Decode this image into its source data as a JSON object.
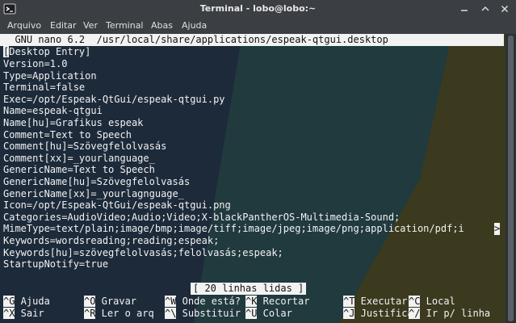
{
  "window": {
    "title": "Terminal - lobo@lobo:~",
    "controls": [
      "minimize-icon",
      "maximize-icon",
      "close-icon"
    ]
  },
  "menu": [
    "Arquivo",
    "Editar",
    "Ver",
    "Terminal",
    "Abas",
    "Ajuda"
  ],
  "nano": {
    "version": "GNU nano 6.2",
    "file_path": "/usr/local/share/applications/espeak-qtgui.desktop",
    "cursor_line_rest": "Desktop Entry]",
    "cursor_char": "[",
    "lines": [
      "Version=1.0",
      "Type=Application",
      "Terminal=false",
      "Exec=/opt/Espeak-QtGui/espeak-qtgui.py",
      "Name=espeak-qtgui",
      "Name[hu]=Grafikus espeak",
      "Comment=Text to Speech",
      "Comment[hu]=Szövegfelolvasás",
      "Comment[xx]=_yourlanguage_",
      "GenericName=Text to Speech",
      "GenericName[hu]=Szövegfelolvasás",
      "GenericName[xx]=_yourlagnguage_",
      "Icon=/opt/Espeak-QtGui/espeak-qtgui.png",
      "Categories=AudioVideo;Audio;Video;X-blackPantherOS-Multimedia-Sound;",
      "MimeType=text/plain;image/bmp;image/tiff;image/jpeg;image/png;application/pdf;i",
      "Keywords=wordsreading;reading;espeak;",
      "Keywords[hu]=szövegfelolvasás;felolvasás;espeak;",
      "StartupNotify=true"
    ],
    "overflow_marker": ">",
    "status": "[ 20 linhas lidas ]",
    "shortcuts_row1": [
      {
        "key": "^G",
        "label": " Ajuda"
      },
      {
        "key": "^O",
        "label": " Gravar"
      },
      {
        "key": "^W",
        "label": " Onde está?"
      },
      {
        "key": "^K",
        "label": " Recortar"
      },
      {
        "key": "^T",
        "label": " Executar"
      },
      {
        "key": "^C",
        "label": " Local"
      }
    ],
    "shortcuts_row2": [
      {
        "key": "^X",
        "label": " Sair"
      },
      {
        "key": "^R",
        "label": " Ler o arq"
      },
      {
        "key": "^\\",
        "label": " Substituir"
      },
      {
        "key": "^U",
        "label": " Colar"
      },
      {
        "key": "^J",
        "label": " Justificar"
      },
      {
        "key": "^/",
        "label": " Ir p/ linha"
      }
    ]
  },
  "colors": {
    "background_navy": "#1d2a3a",
    "background_teal": "#203a3e",
    "background_olive": "#3b3a1e",
    "text": "#f2f2f2"
  }
}
